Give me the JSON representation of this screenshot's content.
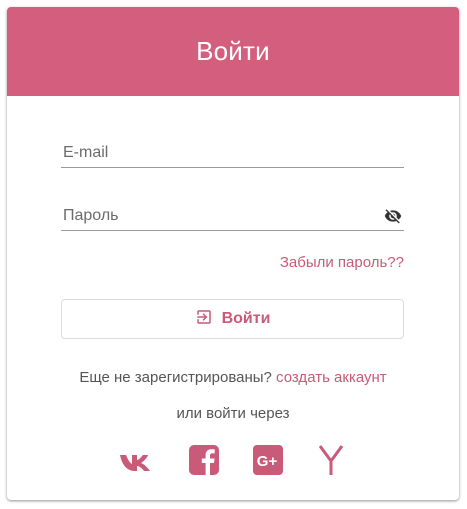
{
  "header": {
    "title": "Войти"
  },
  "form": {
    "email_placeholder": "E-mail",
    "password_placeholder": "Пароль",
    "forgot_label": "Забыли пароль??",
    "login_button_label": "Войти"
  },
  "register": {
    "prompt": "Еще не зарегистрированы?",
    "link_label": "создать аккаунт"
  },
  "social": {
    "caption": "или войти через",
    "providers": [
      "vk-icon",
      "facebook-icon",
      "google-plus-icon",
      "yandex-icon"
    ]
  },
  "colors": {
    "accent": "#d45e7e",
    "link": "#c95a78",
    "text": "#555555"
  }
}
